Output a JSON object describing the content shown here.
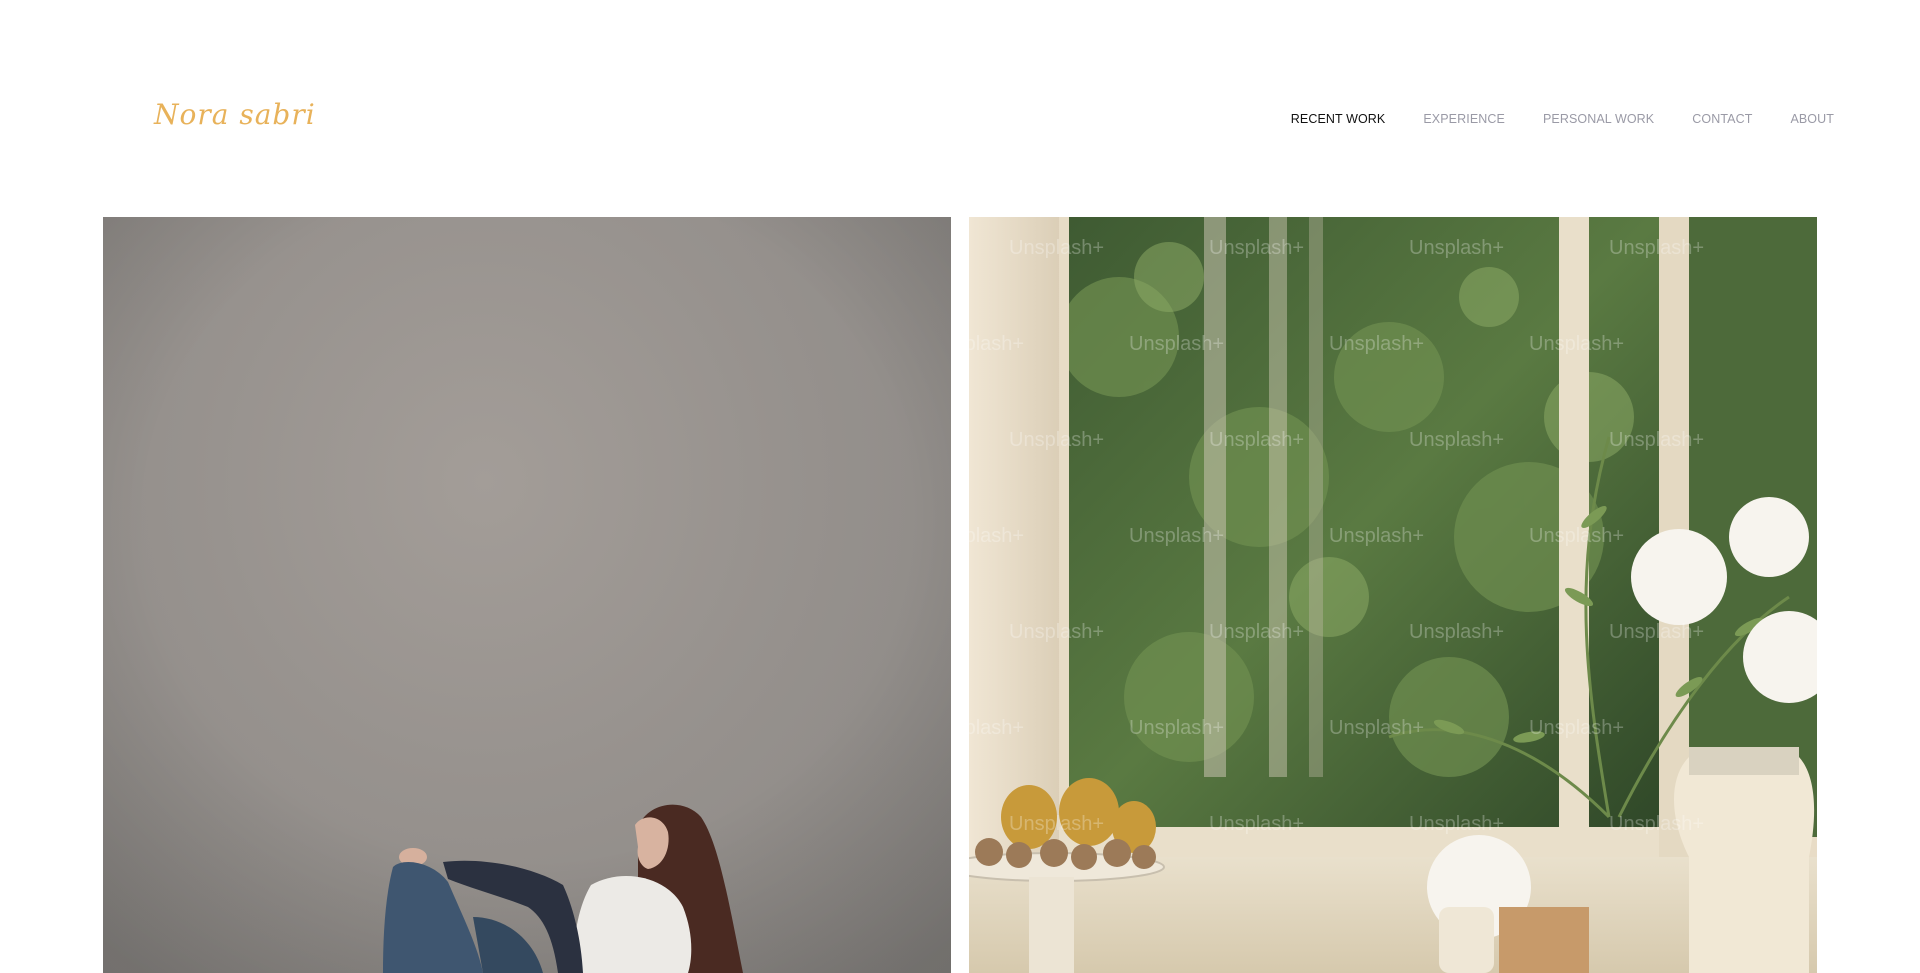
{
  "site": {
    "logo_text": "Nora sabri",
    "brand_color": "#e8b25a"
  },
  "nav": {
    "items": [
      {
        "label": "RECENT WORK",
        "active": true
      },
      {
        "label": "EXPERIENCE",
        "active": false
      },
      {
        "label": "PERSONAL WORK",
        "active": false
      },
      {
        "label": "CONTACT",
        "active": false
      },
      {
        "label": "ABOUT",
        "active": false
      }
    ],
    "active_color": "#111111",
    "inactive_color": "#9a9aa6"
  },
  "gallery": {
    "items": [
      {
        "subject": "woman reclining against grey backdrop"
      },
      {
        "subject": "still life with pears, flowers and window greenery"
      }
    ],
    "watermark_text": "Unsplash+"
  }
}
